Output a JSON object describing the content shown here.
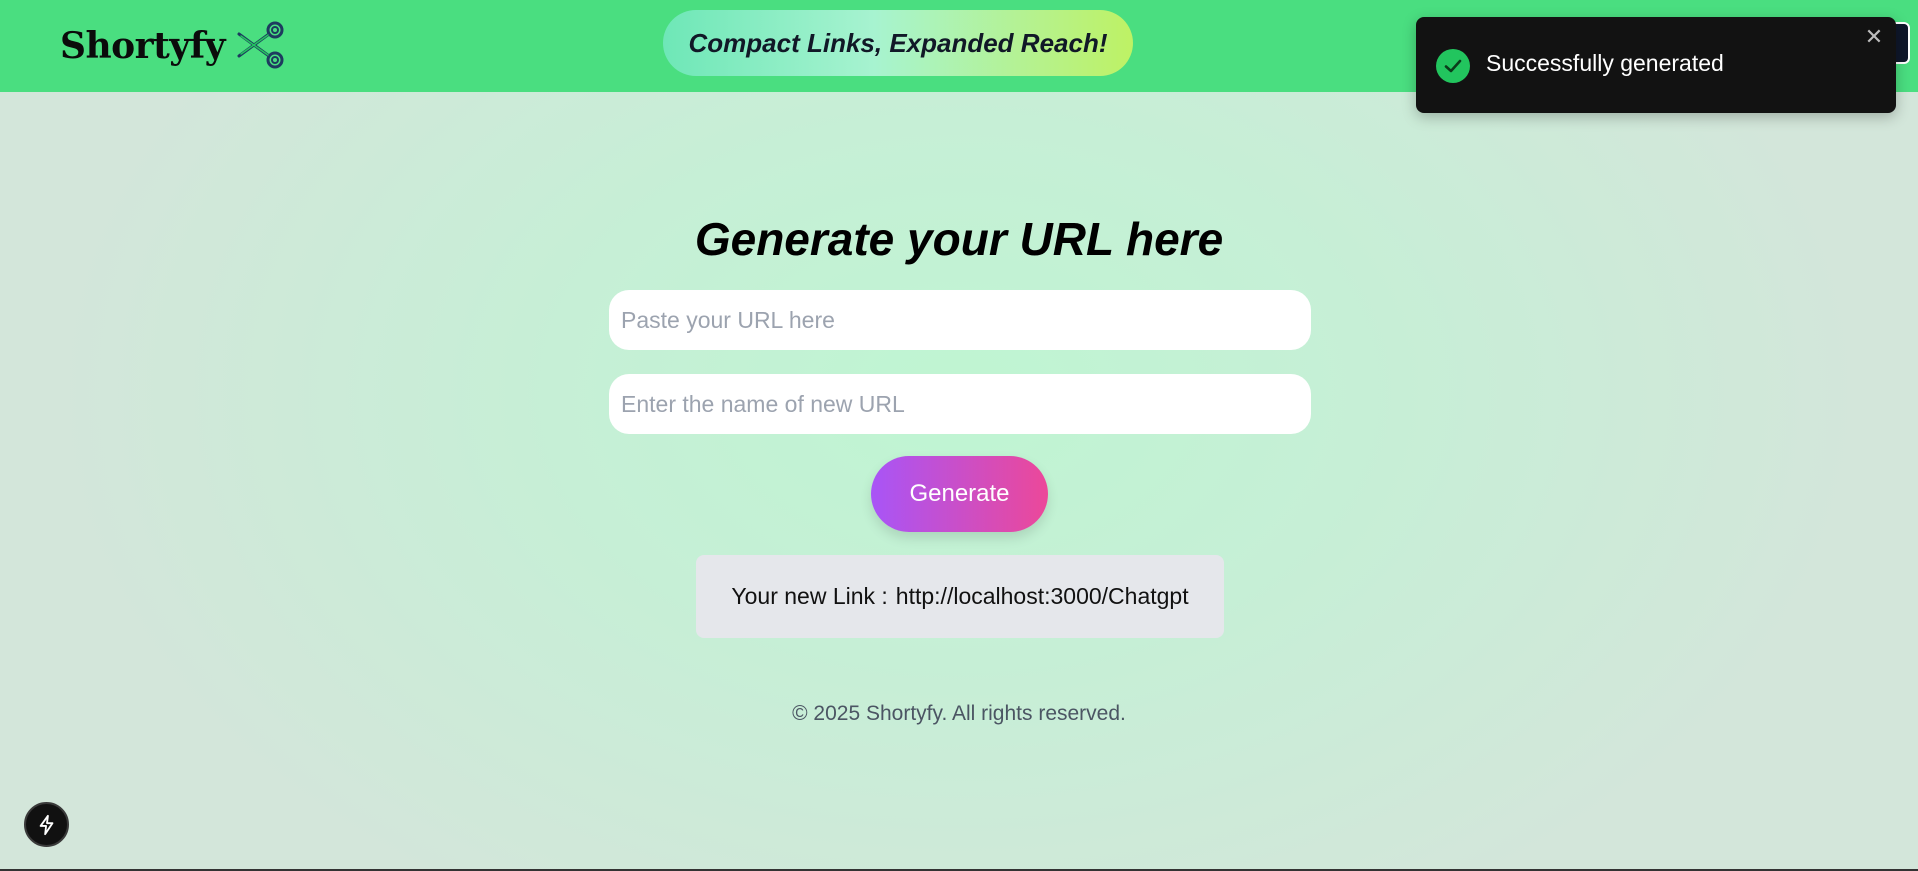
{
  "header": {
    "brand": "Shortyfy",
    "logo_icon": "scissors-icon",
    "tagline": "Compact Links, Expanded Reach!"
  },
  "toast": {
    "icon": "check-circle-icon",
    "message": "Successfully generated",
    "close_icon": "close-icon",
    "close_glyph": "✕"
  },
  "main": {
    "heading": "Generate your URL here",
    "url_input": {
      "placeholder": "Paste your URL here",
      "value": ""
    },
    "name_input": {
      "placeholder": "Enter the name of new URL",
      "value": ""
    },
    "generate_label": "Generate",
    "result": {
      "label": "Your new Link :",
      "url": "http://localhost:3000/Chatgpt"
    }
  },
  "footer": {
    "copyright": "© 2025 Shortyfy. All rights reserved."
  },
  "devtools": {
    "icon": "lightning-bolt-icon"
  },
  "colors": {
    "navbar": "#4ade80",
    "button_start": "#a855f7",
    "button_end": "#ec4899",
    "toast_bg": "#121212",
    "toast_check": "#22c55e"
  }
}
